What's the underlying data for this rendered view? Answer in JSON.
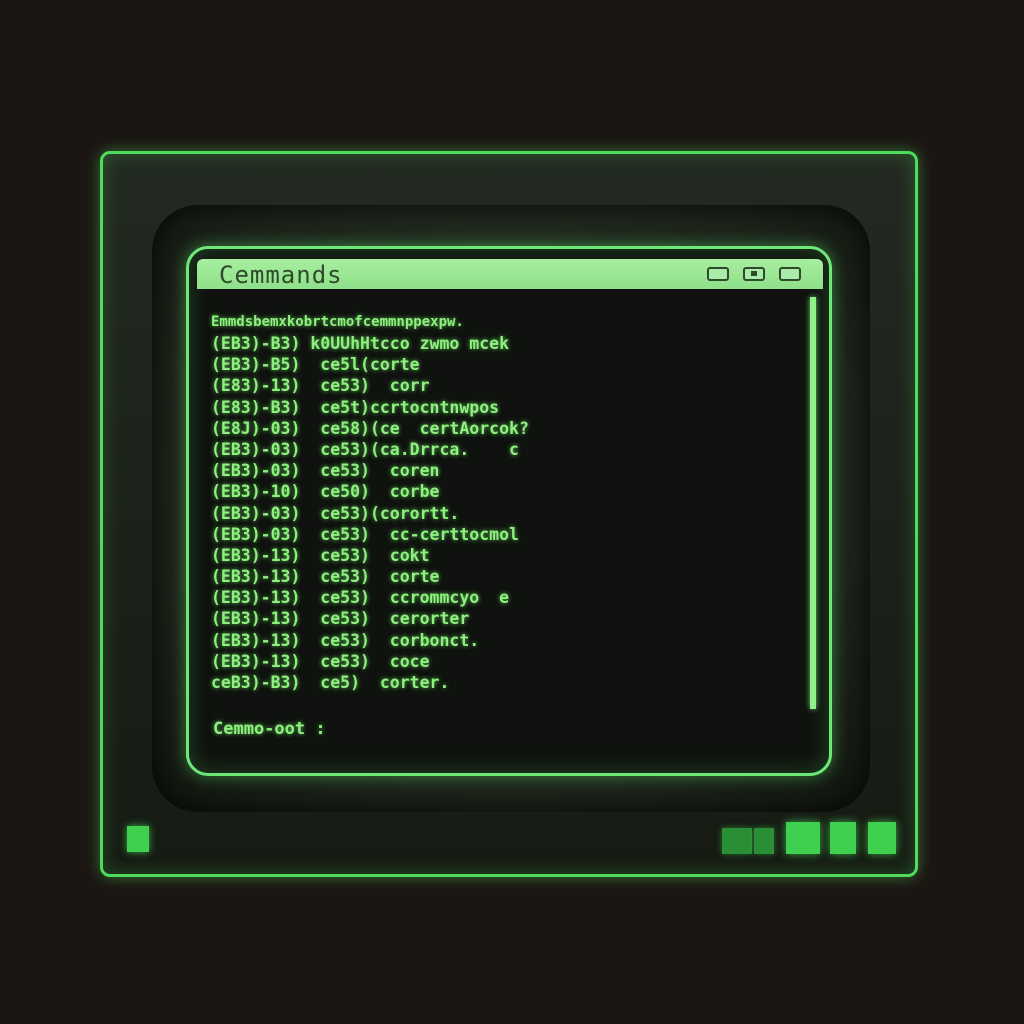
{
  "window": {
    "title": "Cemmands"
  },
  "output_lines": [
    "Emmdsbemxkobrtcmofcemmnppexpw.",
    "(EB3)-B3) k0UUhHtcco zwmo mcek",
    "(EB3)-B5)  ce5l(corte",
    "(E83)-13)  ce53)  corr",
    "(E83)-B3)  ce5t)ccrtocntnwpos",
    "(E8J)-03)  ce58)(ce  certAorcok?",
    "(EB3)-03)  ce53)(ca.Drrca.    c",
    "(EB3)-03)  ce53)  coren",
    "(EB3)-10)  ce50)  corbe",
    "(EB3)-03)  ce53)(corortt.",
    "(EB3)-03)  ce53)  cc-certtocmol",
    "(EB3)-13)  ce53)  cokt",
    "(EB3)-13)  ce53)  corte",
    "(EB3)-13)  ce53)  ccrommcyo  e",
    "(EB3)-13)  ce53)  cerorter",
    "(EB3)-13)  ce53)  corbonct.",
    "(EB3)-13)  ce53)  coce",
    "ceB3)-B3)  ce5)  corter."
  ],
  "prompt": "Cemmo-oot :"
}
